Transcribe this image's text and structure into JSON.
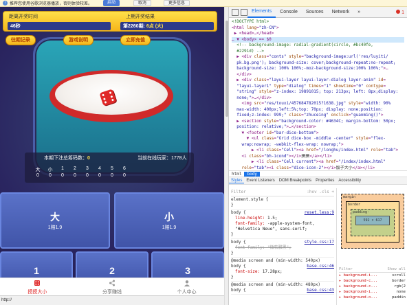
{
  "infobar": {
    "message": "推荐您使用谷歌浏览器播放，否则体验较差。",
    "primary_label": "启动",
    "cancel_label": "取消",
    "more_label": "更多信息"
  },
  "game": {
    "top_left_label": "距离开奖时间",
    "top_left_value": "46秒",
    "top_right_label": "上期开奖结果",
    "top_right_prefix": "第2260期:",
    "top_right_value": "6点 (大)",
    "buttons": [
      "往期记录",
      "游戏说明",
      "立即充值"
    ],
    "stats": {
      "total_label": "本期下注总筹码数：",
      "total_value": "0",
      "players_label": "当前在线玩家：1778人"
    },
    "bet_headers": [
      "大",
      "小",
      "1",
      "2",
      "3",
      "4",
      "5",
      "6"
    ],
    "bet_values": [
      "0",
      "0",
      "0",
      "0",
      "0",
      "0",
      "0",
      "0"
    ],
    "big_label": "大",
    "big_odds": "1赔1.9",
    "small_label": "小",
    "small_odds": "1赔1.9",
    "numbers": [
      "1",
      "2",
      "3"
    ],
    "nav": [
      "摸摸大小",
      "分享赚钱",
      "个人中心"
    ]
  },
  "status_url": "http://",
  "devtools": {
    "tabs": [
      "Elements",
      "Console",
      "Sources",
      "Network"
    ],
    "more": "»",
    "error_count": "1",
    "crumbs": [
      "html",
      "body"
    ],
    "subtabs": [
      "Styles",
      "Event Listeners",
      "DOM Breakpoints",
      "Properties",
      "Accessibility"
    ],
    "filter_placeholder": "Filter",
    "filter_tools": ":hov .cls +",
    "box": {
      "margin": "margin",
      "border": "border",
      "padding": "padding-",
      "content": "592 × 617",
      "dash": "-"
    },
    "computed": {
      "filter": "Filter",
      "show_all": "Show all",
      "rows": [
        {
          "k": "background-i...",
          "v": "scroll"
        },
        {
          "k": "background-c...",
          "v": "border"
        },
        {
          "k": "background-c...",
          "v": "rgb(2"
        },
        {
          "k": "background-i...",
          "v": "none"
        },
        {
          "k": "background-o...",
          "v": "paddin"
        }
      ]
    }
  }
}
